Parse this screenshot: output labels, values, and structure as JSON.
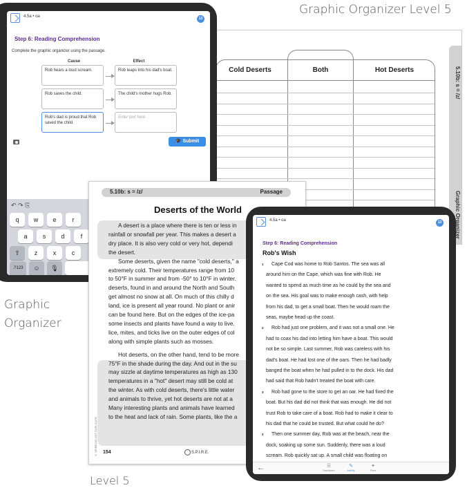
{
  "captions": {
    "top": "Graphic Organizer Level 5",
    "left_line1": "Graphic",
    "left_line2": "Organizer",
    "bottom": "Level 5"
  },
  "worksheet": {
    "tab_top": "5.10b: s = /z/",
    "tab_bottom": "Graphic Organizer",
    "col1": "Cold Deserts",
    "col2": "Both",
    "col3": "Hot Deserts"
  },
  "tablet1": {
    "app_code": "4.5a • oa",
    "badge": "13",
    "step": "Step 6: Reading Comprehension",
    "instruction": "Complete the graphic organizer using the passage.",
    "cause_header": "Cause",
    "effect_header": "Effect",
    "rows": [
      {
        "cause": "Rob hears a loud scream.",
        "effect": "Rob leaps into his dad's boat."
      },
      {
        "cause": "Rob saves the child.",
        "effect": "The child's mother hugs Rob."
      },
      {
        "cause": "Rob's dad is proud that Rob saved the child.",
        "effect_placeholder": "Enter text here"
      }
    ],
    "submit": "Submit",
    "keyboard": {
      "row1": [
        "q",
        "w",
        "e",
        "r"
      ],
      "row2": [
        "a",
        "s",
        "d",
        "f"
      ],
      "row3": [
        "⇧",
        "z",
        "x",
        "c"
      ],
      "row4": [
        ".?123",
        "☺",
        "🎙"
      ],
      "tools": "↶ ↷ ⎘"
    }
  },
  "passage": {
    "header_left": "5.10b: s = /z/",
    "header_right": "Passage",
    "title": "Deserts of the World",
    "lines": [
      "A desert is a place where there is ten or less in",
      "rainfall or snowfall per year. This makes a desert a",
      "dry place. It is also very cold or very hot, dependi",
      "the desert.",
      "Some deserts, given the name \"cold deserts,\" a",
      "extremely cold. Their temperatures range from 10",
      "to 50°F in summer and from -50° to 10°F in winter.",
      "deserts, found in and around the North and South",
      "get almost no snow at all. On much of this chilly d",
      "land, ice is present all year round. No plant or anir",
      "can be found here. But on the edges of the ice-pa",
      "some insects and plants have found a way to live.",
      "lice, mites, and ticks live on the outer edges of col",
      "along with simple plants such as mosses.",
      "Hot deserts, on the other hand, tend to be more",
      "75°F in the shade during the day. And out in the su",
      "may sizzle at daytime temperatures as high as 130",
      "temperatures in a \"hot\" desert may still be cold at",
      "the winter. As with cold deserts, there's little water",
      "and animals to thrive, yet hot deserts are not at a",
      "Many interesting plants and animals have learned",
      "to the heat and lack of rain. Some plants, like the a"
    ],
    "side_note": "© SPIRE DO NOT DUPLICATE",
    "page_number": "154",
    "logo": "S.P.I.R.E."
  },
  "tablet2": {
    "app_code": "4.5a • oa",
    "badge": "13",
    "step": "Step 6: Reading Comprehension",
    "title": "Rob's Wish",
    "paragraph_numbers": [
      "1",
      "2",
      "3",
      "4"
    ],
    "lines": [
      "Cape Cod was home to Rob Santos. The sea was all",
      "around him on the Cape, which was fine with Rob. He",
      "wanted to spend as much time as he could by the sea and",
      "on the sea. His goal was to make enough cash, with help",
      "from his dad, to get a small boat. Then he would roam the",
      "seas, maybe head up the coast.",
      "Rob had just one problem, and it was not a small one. He",
      "had to coax his dad into letting him have a boat. This would",
      "not be so simple. Last summer, Rob was careless with his",
      "dad's boat. He had lost one of the oars. Then he had badly",
      "banged the boat when he had pulled in to the dock. His dad",
      "had said that Rob hadn't treated the boat with care.",
      "Rob had gone to the store to get an oar. He had fixed the",
      "boat. But his dad did not think that was enough. He did not",
      "trust Rob to take care of a boat. Rob had to make it clear to",
      "his dad that he could be trusted. But what could he do?",
      "Then one summer day, Rob was at the beach, near the",
      "dock, soaking up some sun. Suddenly, there was a loud",
      "scream. Rob quickly sat up. A small child was floating on"
    ],
    "nav": [
      "Dashboard",
      "Activity",
      "Plans"
    ]
  }
}
